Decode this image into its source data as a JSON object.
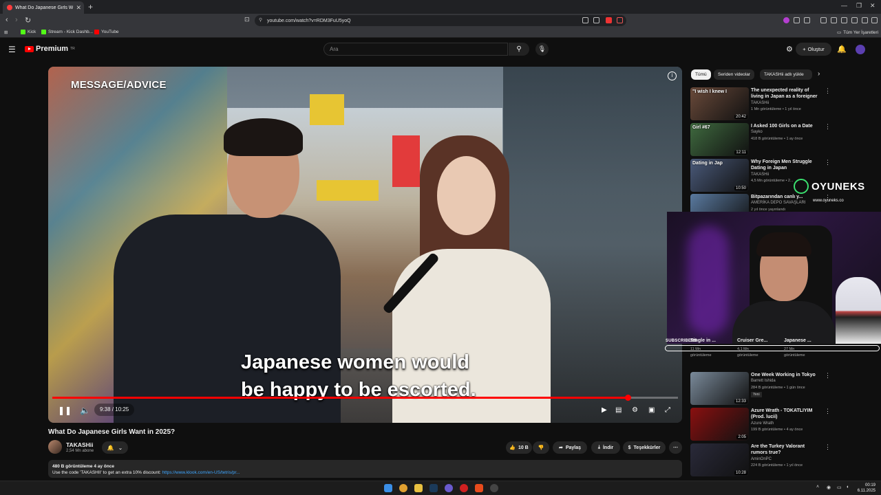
{
  "browser": {
    "tab_title": "What Do Japanese Girls Want",
    "url": "youtube.com/watch?v=RDM3FuU5yoQ",
    "bookmarks": [
      {
        "label": "Kick",
        "color": "#53fc18"
      },
      {
        "label": "Stream - Kick Dashb...",
        "color": "#53fc18"
      },
      {
        "label": "YouTube",
        "color": "#ff0000"
      }
    ],
    "all_bookmarks": "Tüm Yer İşaretleri"
  },
  "youtube": {
    "logo_text": "Premium",
    "logo_sup": "TR",
    "search_placeholder": "Ara",
    "create_label": "Oluştur"
  },
  "video": {
    "overlay_label": "MESSAGE/ADVICE",
    "subtitle_line1": "Japanese women would",
    "subtitle_line2": "be happy to be escorted.",
    "time": "9:38 / 10:25",
    "progress": 0.92,
    "title": "What Do Japanese Girls Want in 2025?",
    "channel": "TAKASHii",
    "subscribers": "2,54 Mn abone",
    "likes": "10 B",
    "share_label": "Paylaş",
    "download_label": "İndir",
    "thanks_label": "Teşekkürler",
    "description_stats": "480 B görüntüleme   4 ay önce",
    "description_text": "Use the code 'TAKASHII' to get an extra 10% discount: ",
    "description_link": "https://www.klook.com/en-US/tetris/pr..."
  },
  "sidebar": {
    "chips": [
      "Tümü",
      "Seriden videolar",
      "TAKASHii adlı yükle"
    ],
    "recs_top": [
      {
        "title": "The unexpected reality of living in Japan as a foreigner",
        "channel": "TAKASHii",
        "meta": "1 Mn görüntüleme • 1 yıl önce",
        "duration": "20:42",
        "overlay": "\"I wish I knew I",
        "thumb": "#6a4a3a"
      },
      {
        "title": "I Asked 100 Girls on a Date",
        "channel": "Sayko",
        "meta": "418 B görüntüleme • 1 ay önce",
        "duration": "12:11",
        "overlay": "Girl #67",
        "thumb": "#3f6a3f"
      },
      {
        "title": "Why Foreign Men Struggle Dating in Japan",
        "channel": "TAKASHii",
        "meta": "4,5 Mn görüntüleme • 2...",
        "duration": "10:50",
        "overlay": "Dating in Jap",
        "thumb": "#4a5a7a"
      },
      {
        "title": "Bitpazarından canlı y...",
        "channel": "AMERİKA DEPO SAVAŞLARI",
        "meta": "2 yıl önce yayınlandı",
        "duration": "",
        "overlay": "",
        "thumb": "#5a7aa0"
      }
    ],
    "shorts": [
      {
        "title": "Single in ...",
        "views": "11 Mn",
        "label": "görüntüleme"
      },
      {
        "title": "Cruiser Gre...",
        "views": "4,1 Mn",
        "label": "görüntüleme"
      },
      {
        "title": "Japanese ...",
        "views": "27 Mn",
        "label": "görüntüleme"
      }
    ],
    "recs_bottom": [
      {
        "title": "One Week Working in Tokyo",
        "channel": "Barrett Ishida",
        "meta": "284 B görüntüleme • 1 gün önce",
        "badge": "Yeni",
        "duration": "12:33",
        "thumb": "#7a8a9a"
      },
      {
        "title": "Azure Wrath - TOKATLIYIM (Prod. lucii)",
        "channel": "Azure Wrath",
        "meta": "199 B görüntüleme • 4 ay önce",
        "badge": "",
        "duration": "2:05",
        "thumb": "#8a1010"
      },
      {
        "title": "Are the Turkey Valorant rumors true?",
        "channel": "AminOnPC",
        "meta": "224 B görüntüleme • 1 yıl önce",
        "badge": "",
        "duration": "10:28",
        "thumb": "#2a2a3a"
      }
    ]
  },
  "overlay": {
    "brand": "OYUNEKS",
    "brand_url": "www.oyuneks.co",
    "brand_color": "#3be06f",
    "subscribers_label": "SUBSCRIBERS"
  },
  "taskbar": {
    "time": "00:19",
    "date": "6.11.2025"
  }
}
